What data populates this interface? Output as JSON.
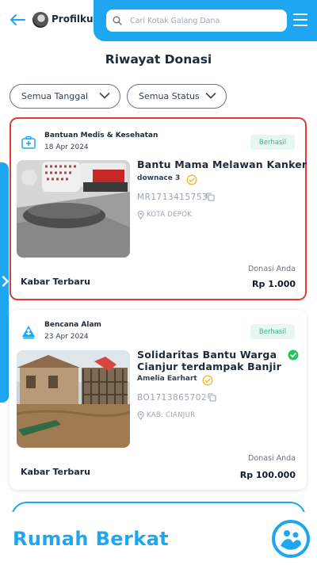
{
  "header": {
    "profile_label": "Profilku",
    "search_placeholder": "Cari Kotak Galang Dana"
  },
  "page": {
    "title": "Riwayat Donasi"
  },
  "filters": {
    "date_label": "Semua Tanggal",
    "status_label": "Semua Status"
  },
  "donations": [
    {
      "category": "Bantuan Medis & Kesehatan",
      "category_icon": "medical-kit-icon",
      "date": "18 Apr 2024",
      "status": "Berhasil",
      "title": "Bantu Mama Melawan Kanker",
      "organizer": "downace 3",
      "code": "MR1713415753",
      "location": "KOTA DEPOK",
      "donation_label": "Donasi Anda",
      "amount": "Rp 1.000",
      "news_label": "Kabar Terbaru"
    },
    {
      "category": "Bencana Alam",
      "category_icon": "disaster-icon",
      "date": "23 Apr 2024",
      "status": "Berhasil",
      "title_line1": "Solidaritas Bantu Warga",
      "title_line2": "Cianjur terdampak Banjir",
      "organizer": "Amelia Earhart",
      "code": "BO1713865702",
      "location": "KAB. CIANJUR",
      "donation_label": "Donasi Anda",
      "amount": "Rp 100.000",
      "news_label": "Kabar Terbaru"
    }
  ],
  "footer": {
    "brand": "Rumah Berkat"
  },
  "colors": {
    "primary": "#1ea7f0",
    "success_text": "#3bb78f",
    "success_bg": "#e6f6f1",
    "verified": "#f5b82e",
    "selection_border": "#e53935"
  }
}
